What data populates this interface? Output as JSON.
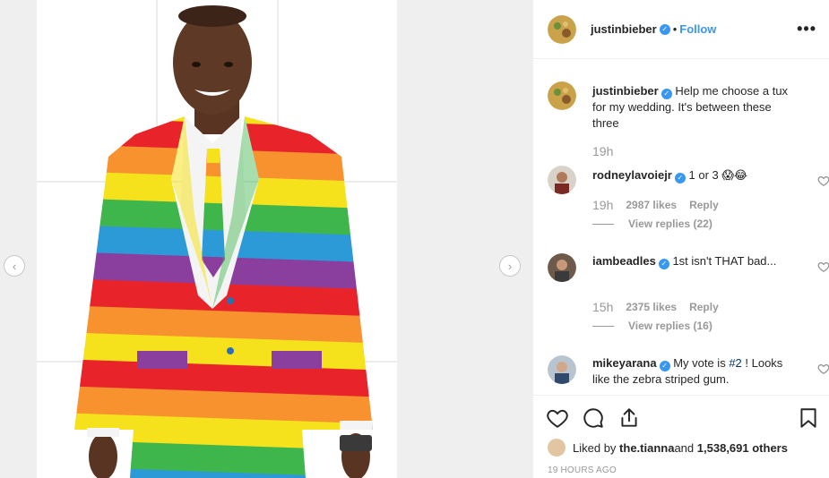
{
  "post": {
    "author": "justinbieber",
    "follow_label": "Follow",
    "separator": "•",
    "more_label": "•••"
  },
  "caption": {
    "username": "justinbieber",
    "text": "Help me choose a tux for my wedding. It's between these three",
    "time": "19h"
  },
  "comments": [
    {
      "username": "rodneylavoiejr",
      "text": "1 or 3 😱😂",
      "time": "19h",
      "likes": "2987 likes",
      "reply_label": "Reply",
      "view_replies": "View replies (22)"
    },
    {
      "username": "iambeadles",
      "text": "1st isn't THAT bad...",
      "time": "15h",
      "likes": "2375 likes",
      "reply_label": "Reply",
      "view_replies": "View replies (16)"
    },
    {
      "username": "mikeyarana",
      "text_before": "My vote is ",
      "hashtag": "#2",
      "text_after": " ! Looks like the zebra striped gum."
    }
  ],
  "likes_summary": {
    "prefix": "Liked by ",
    "first_user": "the.tianna",
    "joiner": " and ",
    "others": "1,538,691 others"
  },
  "timestamp": "19 HOURS AGO",
  "colors": {
    "accent": "#3897f0",
    "text": "#262626",
    "muted": "#999999",
    "border": "#efefef"
  },
  "icons": {
    "prev": "chevron-left-icon",
    "next": "chevron-right-icon",
    "like": "heart-icon",
    "comment": "comment-bubble-icon",
    "share": "share-icon",
    "save": "bookmark-icon",
    "more": "more-options-icon"
  }
}
